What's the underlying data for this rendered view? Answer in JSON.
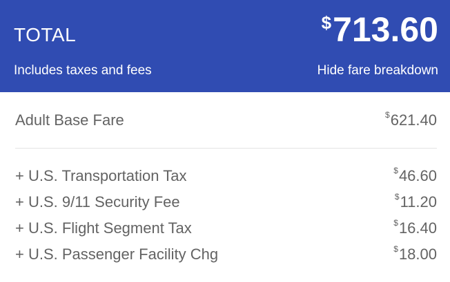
{
  "header": {
    "title": "TOTAL",
    "currency": "$",
    "amount": "713.60",
    "subtitle": "Includes taxes and fees",
    "toggle_link": "Hide fare breakdown"
  },
  "base_fare": {
    "label": "Adult Base Fare",
    "currency": "$",
    "amount": "621.40"
  },
  "taxes": [
    {
      "label": "+ U.S. Transportation Tax",
      "currency": "$",
      "amount": "46.60"
    },
    {
      "label": "+ U.S. 9/11 Security Fee",
      "currency": "$",
      "amount": "11.20"
    },
    {
      "label": "+ U.S. Flight Segment Tax",
      "currency": "$",
      "amount": "16.40"
    },
    {
      "label": "+ U.S. Passenger Facility Chg",
      "currency": "$",
      "amount": "18.00"
    }
  ],
  "colors": {
    "header_bg": "#304cb2",
    "header_text": "#ffffff",
    "body_text": "#636363",
    "divider": "#e3e3e3"
  }
}
